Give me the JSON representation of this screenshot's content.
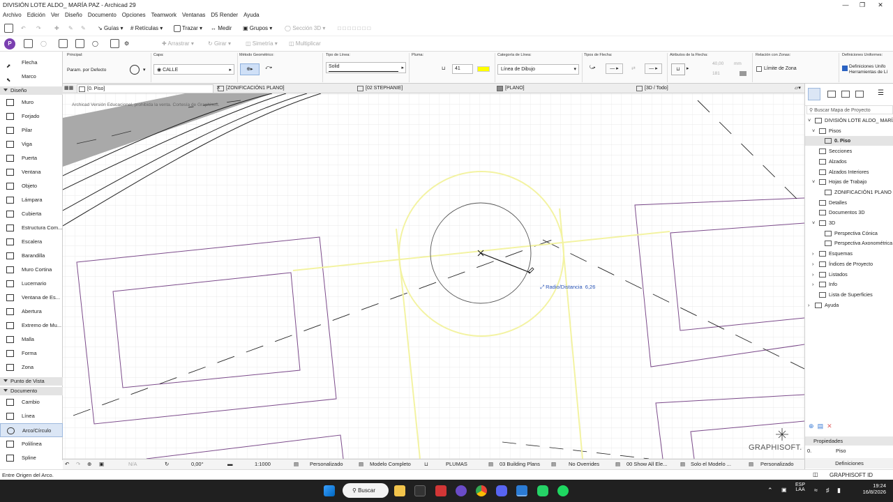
{
  "window": {
    "title": "DIVISIÓN LOTE ALDO_ MARÍA PAZ - Archicad 29"
  },
  "menu": [
    "Archivo",
    "Edición",
    "Ver",
    "Diseño",
    "Documento",
    "Opciones",
    "Teamwork",
    "Ventanas",
    "D5 Render",
    "Ayuda"
  ],
  "toolbar": {
    "guias": "Guías",
    "reticulas": "Retículas",
    "trazar": "Trazar",
    "medir": "Medir",
    "grupos": "Grupos",
    "seccion3d": "Sección 3D",
    "arrastrar": "Arrastrar",
    "girar": "Girar",
    "simetria": "Simetría",
    "multiplicar": "Multiplicar"
  },
  "infobox": {
    "principal_label": "Principal:",
    "principal_value": "Param. por Defecto",
    "capa_label": "Capa:",
    "capa_value": "CALLE",
    "metodo_label": "Método Geométrico:",
    "tipo_linea_label": "Tipo de Línea:",
    "tipo_linea_value": "Solid",
    "pluma_label": "Pluma:",
    "pluma_value": "41",
    "categoria_label": "Categoría de Línea:",
    "categoria_value": "Línea de Dibujo",
    "flecha_label": "Tipos de Flecha:",
    "atributos_label": "Atributos de la Flecha:",
    "atr_size": "40,00",
    "atr_unit": "mm",
    "atr_pen": "181",
    "zonas_label": "Relación con Zonas:",
    "zonas_value": "Límite de Zona",
    "uniformes_label": "Definiciones Uniformes:",
    "uniformes_value1": "Definiciones Unifo",
    "uniformes_value2": "Herramientas de Lí"
  },
  "toolbox": {
    "flecha": "Flecha",
    "marco": "Marco",
    "diseno": "Diseño",
    "items": [
      "Muro",
      "Forjado",
      "Pilar",
      "Viga",
      "Puerta",
      "Ventana",
      "Objeto",
      "Lámpara",
      "Cubierta",
      "Estructura Com...",
      "Escalera",
      "Barandilla",
      "Muro Cortina",
      "Lucernario",
      "Ventana de Es...",
      "Abertura",
      "Extremo de Mu...",
      "Malla",
      "Forma",
      "Zona"
    ],
    "punto_vista": "Punto de Vista",
    "documento": "Documento",
    "doc_items": [
      "Cambio",
      "Línea",
      "Arco/Círculo",
      "Polilínea",
      "Spline"
    ]
  },
  "tabs": [
    "[0. Piso]",
    "[ZONIFICACIÓN1 PLANO]",
    "[02 STEPHANIE]",
    "[PLANO]",
    "[3D / Todo]"
  ],
  "canvas": {
    "watermark": "Archicad Versión Educacional, prohibida la venta. Cortesía de Graphisoft.",
    "tracker_label": "Radio/Distancia",
    "tracker_value": "6,26",
    "brand": "GRAPHISOFT."
  },
  "statusrow": {
    "na": "N/A",
    "angle": "0,00°",
    "scale": "1:1000",
    "personalizado": "Personalizado",
    "modelo": "Modelo Completo",
    "plumas": "PLUMAS",
    "building": "03 Building Plans",
    "overrides": "No Overrides",
    "show": "00 Show All Ele...",
    "solo": "Solo el Modelo ...",
    "personalizado2": "Personalizado"
  },
  "navigator": {
    "search_placeholder": "Buscar Mapa de Proyecto",
    "items": [
      "DIVISIÓN LOTE ALDO_ MARÍA",
      "Pisos",
      "0. Piso",
      "Secciones",
      "Alzados",
      "Alzados Interiores",
      "Hojas de Trabajo",
      "ZONIFICACIÓN1 PLANO (",
      "Detalles",
      "Documentos 3D",
      "3D",
      "Perspectiva Cónica",
      "Perspectiva Axonométrica",
      "Esquemas",
      "Índices de Proyecto",
      "Listados",
      "Info",
      "Lista de Superficies",
      "Ayuda"
    ],
    "propiedades": "Propiedades",
    "prop_num": "0.",
    "prop_name": "Piso",
    "definiciones": "Definiciones"
  },
  "bottom": {
    "status": "Entre Origen del Arco.",
    "graphisoft_id": "GRAPHISOFT ID"
  },
  "taskbar": {
    "search": "Buscar",
    "lang1": "ESP",
    "lang2": "LAA",
    "time": "19:24",
    "date": "16/8/2026"
  }
}
